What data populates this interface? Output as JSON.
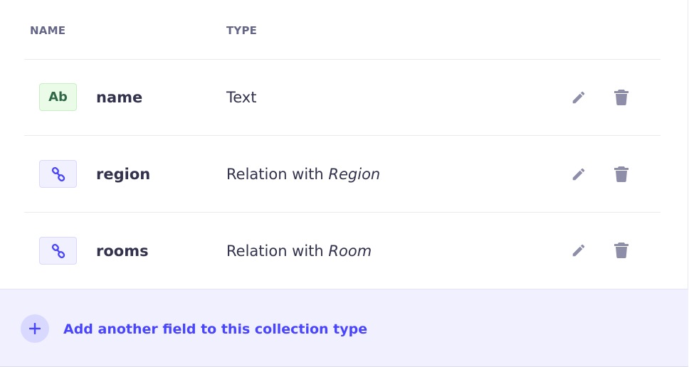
{
  "header": {
    "name_label": "NAME",
    "type_label": "TYPE"
  },
  "fields": [
    {
      "icon": "text-icon",
      "badge": "Ab",
      "name": "name",
      "type_prefix": "Text",
      "type_target": ""
    },
    {
      "icon": "link-icon",
      "badge": "",
      "name": "region",
      "type_prefix": "Relation with ",
      "type_target": "Region"
    },
    {
      "icon": "link-icon",
      "badge": "",
      "name": "rooms",
      "type_prefix": "Relation with ",
      "type_target": "Room"
    }
  ],
  "actions": {
    "edit_icon": "pencil-icon",
    "delete_icon": "trash-icon"
  },
  "footer": {
    "add_label": "Add another field to this collection type",
    "add_icon": "plus-icon"
  },
  "colors": {
    "accent": "#4945ff",
    "muted_icon": "#8e8ea9",
    "text_badge_bg": "#eafbe7",
    "relation_badge_bg": "#f0f0ff"
  }
}
